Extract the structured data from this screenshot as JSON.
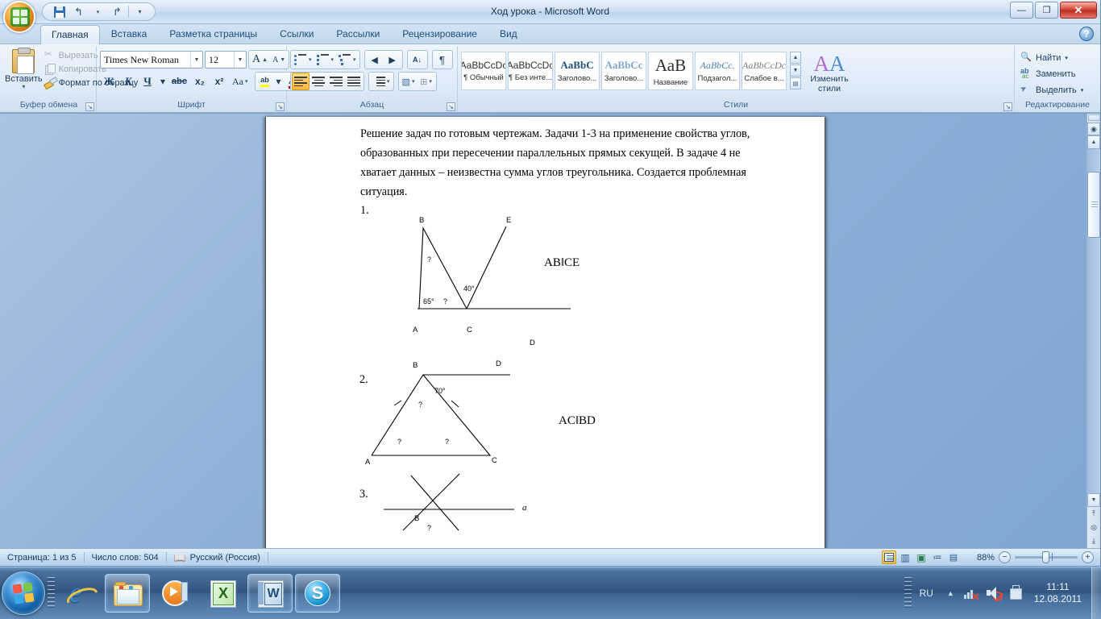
{
  "window": {
    "title": "Ход урока - Microsoft Word",
    "minimize_label": "—",
    "maximize_label": "❐",
    "close_label": "✕",
    "help_label": "?"
  },
  "quick_access": {
    "save_tooltip": "Сохранить",
    "undo_label": "↰",
    "undo_caret": "▾",
    "redo_label": "↱",
    "customize_caret": "▾"
  },
  "tabs": [
    {
      "label": "Главная",
      "active": true
    },
    {
      "label": "Вставка",
      "active": false
    },
    {
      "label": "Разметка страницы",
      "active": false
    },
    {
      "label": "Ссылки",
      "active": false
    },
    {
      "label": "Рассылки",
      "active": false
    },
    {
      "label": "Рецензирование",
      "active": false
    },
    {
      "label": "Вид",
      "active": false
    }
  ],
  "ribbon": {
    "clipboard": {
      "group_label": "Буфер обмена",
      "paste_label": "Вставить",
      "paste_caret": "▾",
      "cut_label": "Вырезать",
      "copy_label": "Копировать",
      "format_painter_label": "Формат по образцу"
    },
    "font": {
      "group_label": "Шрифт",
      "font_name": "Times New Roman",
      "font_size": "12",
      "grow_font": "A",
      "shrink_font": "A",
      "clear_format": "Aa",
      "bold": "Ж",
      "italic": "К",
      "underline": "Ч",
      "underline_caret": "▾",
      "strikethrough": "abc",
      "subscript": "x₂",
      "superscript": "x²",
      "change_case": "Aa",
      "change_case_caret": "▾",
      "highlight": "ab",
      "highlight_caret": "▾",
      "font_color": "A",
      "font_color_caret": "▾",
      "highlight_color": "#ffff00",
      "text_color": "#cc0000"
    },
    "paragraph": {
      "group_label": "Абзац",
      "bullets_caret": "▾",
      "numbering_caret": "▾",
      "multilevel_caret": "▾",
      "decrease_indent": "◀",
      "increase_indent": "▶",
      "sort": "А↓",
      "show_marks": "¶",
      "align_left": "≡",
      "align_center": "≡",
      "align_right": "≡",
      "justify": "≡",
      "line_spacing_caret": "▾",
      "shading_caret": "▾",
      "borders_caret": "▾"
    },
    "styles": {
      "group_label": "Стили",
      "items": [
        {
          "preview": "AaBbCcDc",
          "name": "¶ Обычный",
          "kind": "sans"
        },
        {
          "preview": "AaBbCcDc",
          "name": "¶ Без инте...",
          "kind": "sans"
        },
        {
          "preview": "AaBbC",
          "name": "Заголово...",
          "kind": "serif"
        },
        {
          "preview": "AaBbCc",
          "name": "Заголово...",
          "kind": "lt"
        },
        {
          "preview": "АаВ",
          "name": "Название",
          "kind": "big"
        },
        {
          "preview": "AaBbCc.",
          "name": "Подзагол...",
          "kind": "ital"
        },
        {
          "preview": "AaBbCcDc",
          "name": "Слабое в...",
          "kind": "ital2"
        }
      ],
      "scroll_up": "▲",
      "scroll_down": "▼",
      "more": "▤",
      "change_styles_label": "Изменить стили",
      "change_styles_caret": "▾"
    },
    "editing": {
      "group_label": "Редактирование",
      "find_label": "Найти",
      "find_caret": "▾",
      "replace_label": "Заменить",
      "select_label": "Выделить",
      "select_caret": "▾"
    }
  },
  "document": {
    "paragraph": "Решение задач по готовым чертежам.  Задачи 1-3 на применение свойства углов, образованных при пересечении параллельных прямых секущей. В задаче 4 не хватает данных – неизвестна сумма углов треугольника. Создается проблемная ситуация.",
    "figures": [
      {
        "number": "1.",
        "vertex_labels": [
          "B",
          "E",
          "A",
          "C",
          "D"
        ],
        "angles": [
          "?",
          "?",
          "65°",
          "40°"
        ],
        "caption": "AB‖CE"
      },
      {
        "number": "2.",
        "vertex_labels": [
          "B",
          "D",
          "A",
          "C"
        ],
        "angles": [
          "70°",
          "?",
          "?",
          "?"
        ],
        "caption": "AC‖BD"
      },
      {
        "number": "3.",
        "vertex_labels": [
          "B"
        ],
        "line_label": "a",
        "angles": [
          "?"
        ],
        "caption": ""
      }
    ]
  },
  "scrollbar": {
    "split_tooltip": "Разделить",
    "select_browse_object": "◉",
    "arrow_up": "▲",
    "arrow_down": "▼",
    "prev_page": "⤒",
    "browse_object": "◎",
    "next_page": "⤓"
  },
  "statusbar": {
    "page_label": "Страница: 1 из 5",
    "words_label": "Число слов: 504",
    "language_label": "Русский (Россия)",
    "zoom_level": "88%",
    "zoom_out": "−",
    "zoom_in": "+",
    "views": [
      {
        "name": "print-layout",
        "glyph": "▤",
        "active": true
      },
      {
        "name": "full-screen-reading",
        "glyph": "📖",
        "active": false
      },
      {
        "name": "web-layout",
        "glyph": "🌐",
        "active": false
      },
      {
        "name": "outline",
        "glyph": "≔",
        "active": false
      },
      {
        "name": "draft",
        "glyph": "▤",
        "active": false
      }
    ]
  },
  "taskbar": {
    "start_tooltip": "Пуск",
    "items": [
      {
        "name": "internet-explorer",
        "open": false
      },
      {
        "name": "windows-explorer",
        "open": true
      },
      {
        "name": "windows-media-player",
        "open": false
      },
      {
        "name": "microsoft-excel",
        "open": false
      },
      {
        "name": "microsoft-word",
        "open": true
      },
      {
        "name": "skype",
        "open": true
      }
    ],
    "skype_glyph": "S",
    "language": "RU",
    "show_hidden": "▲",
    "time": "11:11",
    "date": "12.08.2011"
  }
}
